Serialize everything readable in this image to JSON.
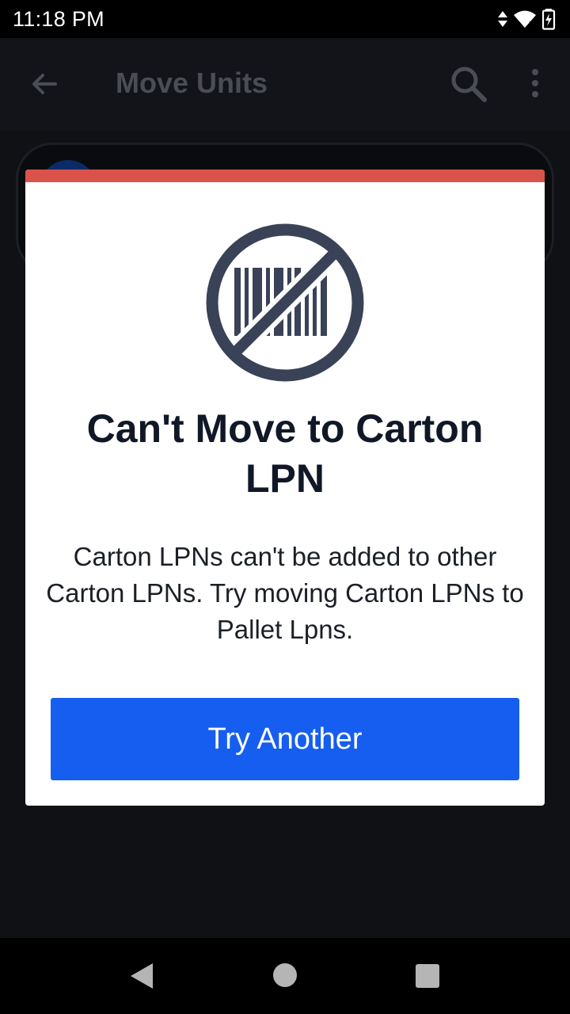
{
  "status_bar": {
    "time": "11:18 PM",
    "icons": [
      "data-arrows-icon",
      "wifi-icon",
      "battery-charging-icon"
    ]
  },
  "app_bar": {
    "title": "Move Units",
    "icons": [
      "back-arrow-icon",
      "search-icon",
      "more-vert-icon"
    ]
  },
  "dialog": {
    "icon": "no-barcode-icon",
    "title": "Can't Move to Carton LPN",
    "message": "Carton LPNs can't be added to other Carton LPNs. Try moving Carton LPNs to Pallet Lpns.",
    "primary_button_label": "Try Another",
    "accent_color": "#d9534a",
    "button_color": "#155eef"
  },
  "nav_bar": {
    "icons": [
      "nav-back-icon",
      "nav-home-icon",
      "nav-recents-icon"
    ]
  }
}
